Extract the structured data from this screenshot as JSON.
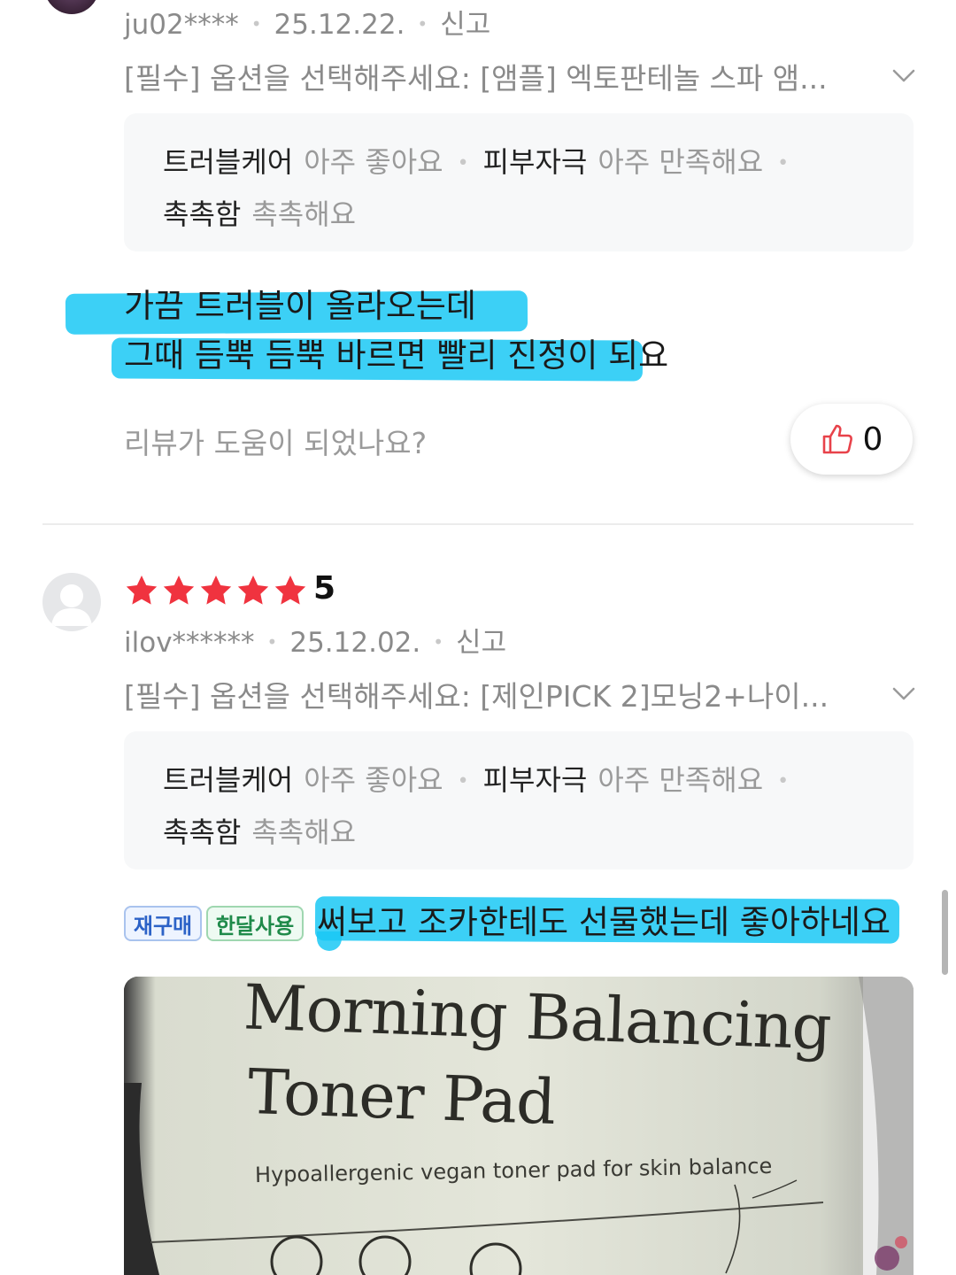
{
  "review1": {
    "username": "ju02****",
    "date": "25.12.22.",
    "report_label": "신고",
    "option_text": "[필수] 옵션을 선택해주세요: [앰플] 엑토판테놀 스파 앰...",
    "attrs": [
      {
        "key": "트러블케어",
        "value": "아주 좋아요"
      },
      {
        "key": "피부자극",
        "value": "아주 만족해요"
      },
      {
        "key": "촉촉함",
        "value": "촉촉해요"
      }
    ],
    "body_line1": "가끔 트러블이 올라오는데",
    "body_line2": "그때 듬뿍 듬뿍 바르면 빨리 진정이 되요",
    "helpful_question": "리뷰가 도움이 되었나요?",
    "like_count": "0"
  },
  "review2": {
    "rating": 5,
    "rating_label": "5",
    "username": "ilov******",
    "date": "25.12.02.",
    "report_label": "신고",
    "option_text": "[필수] 옵션을 선택해주세요: [제인PICK 2]모닝2+나이...",
    "attrs": [
      {
        "key": "트러블케어",
        "value": "아주 좋아요"
      },
      {
        "key": "피부자극",
        "value": "아주 만족해요"
      },
      {
        "key": "촉촉함",
        "value": "촉촉해요"
      }
    ],
    "tags": [
      "재구매",
      "한달사용"
    ],
    "body_text": "써보고 조카한테도 선물했는데 좋아하네요",
    "photo": {
      "title_line1": "Morning Balancing",
      "title_line2": "Toner Pad",
      "subtitle": "Hypoallergenic vegan toner pad for skin balance"
    }
  },
  "colors": {
    "highlight": "#1ac8f5",
    "star": "#f0333f",
    "like_icon": "#e8424a"
  }
}
